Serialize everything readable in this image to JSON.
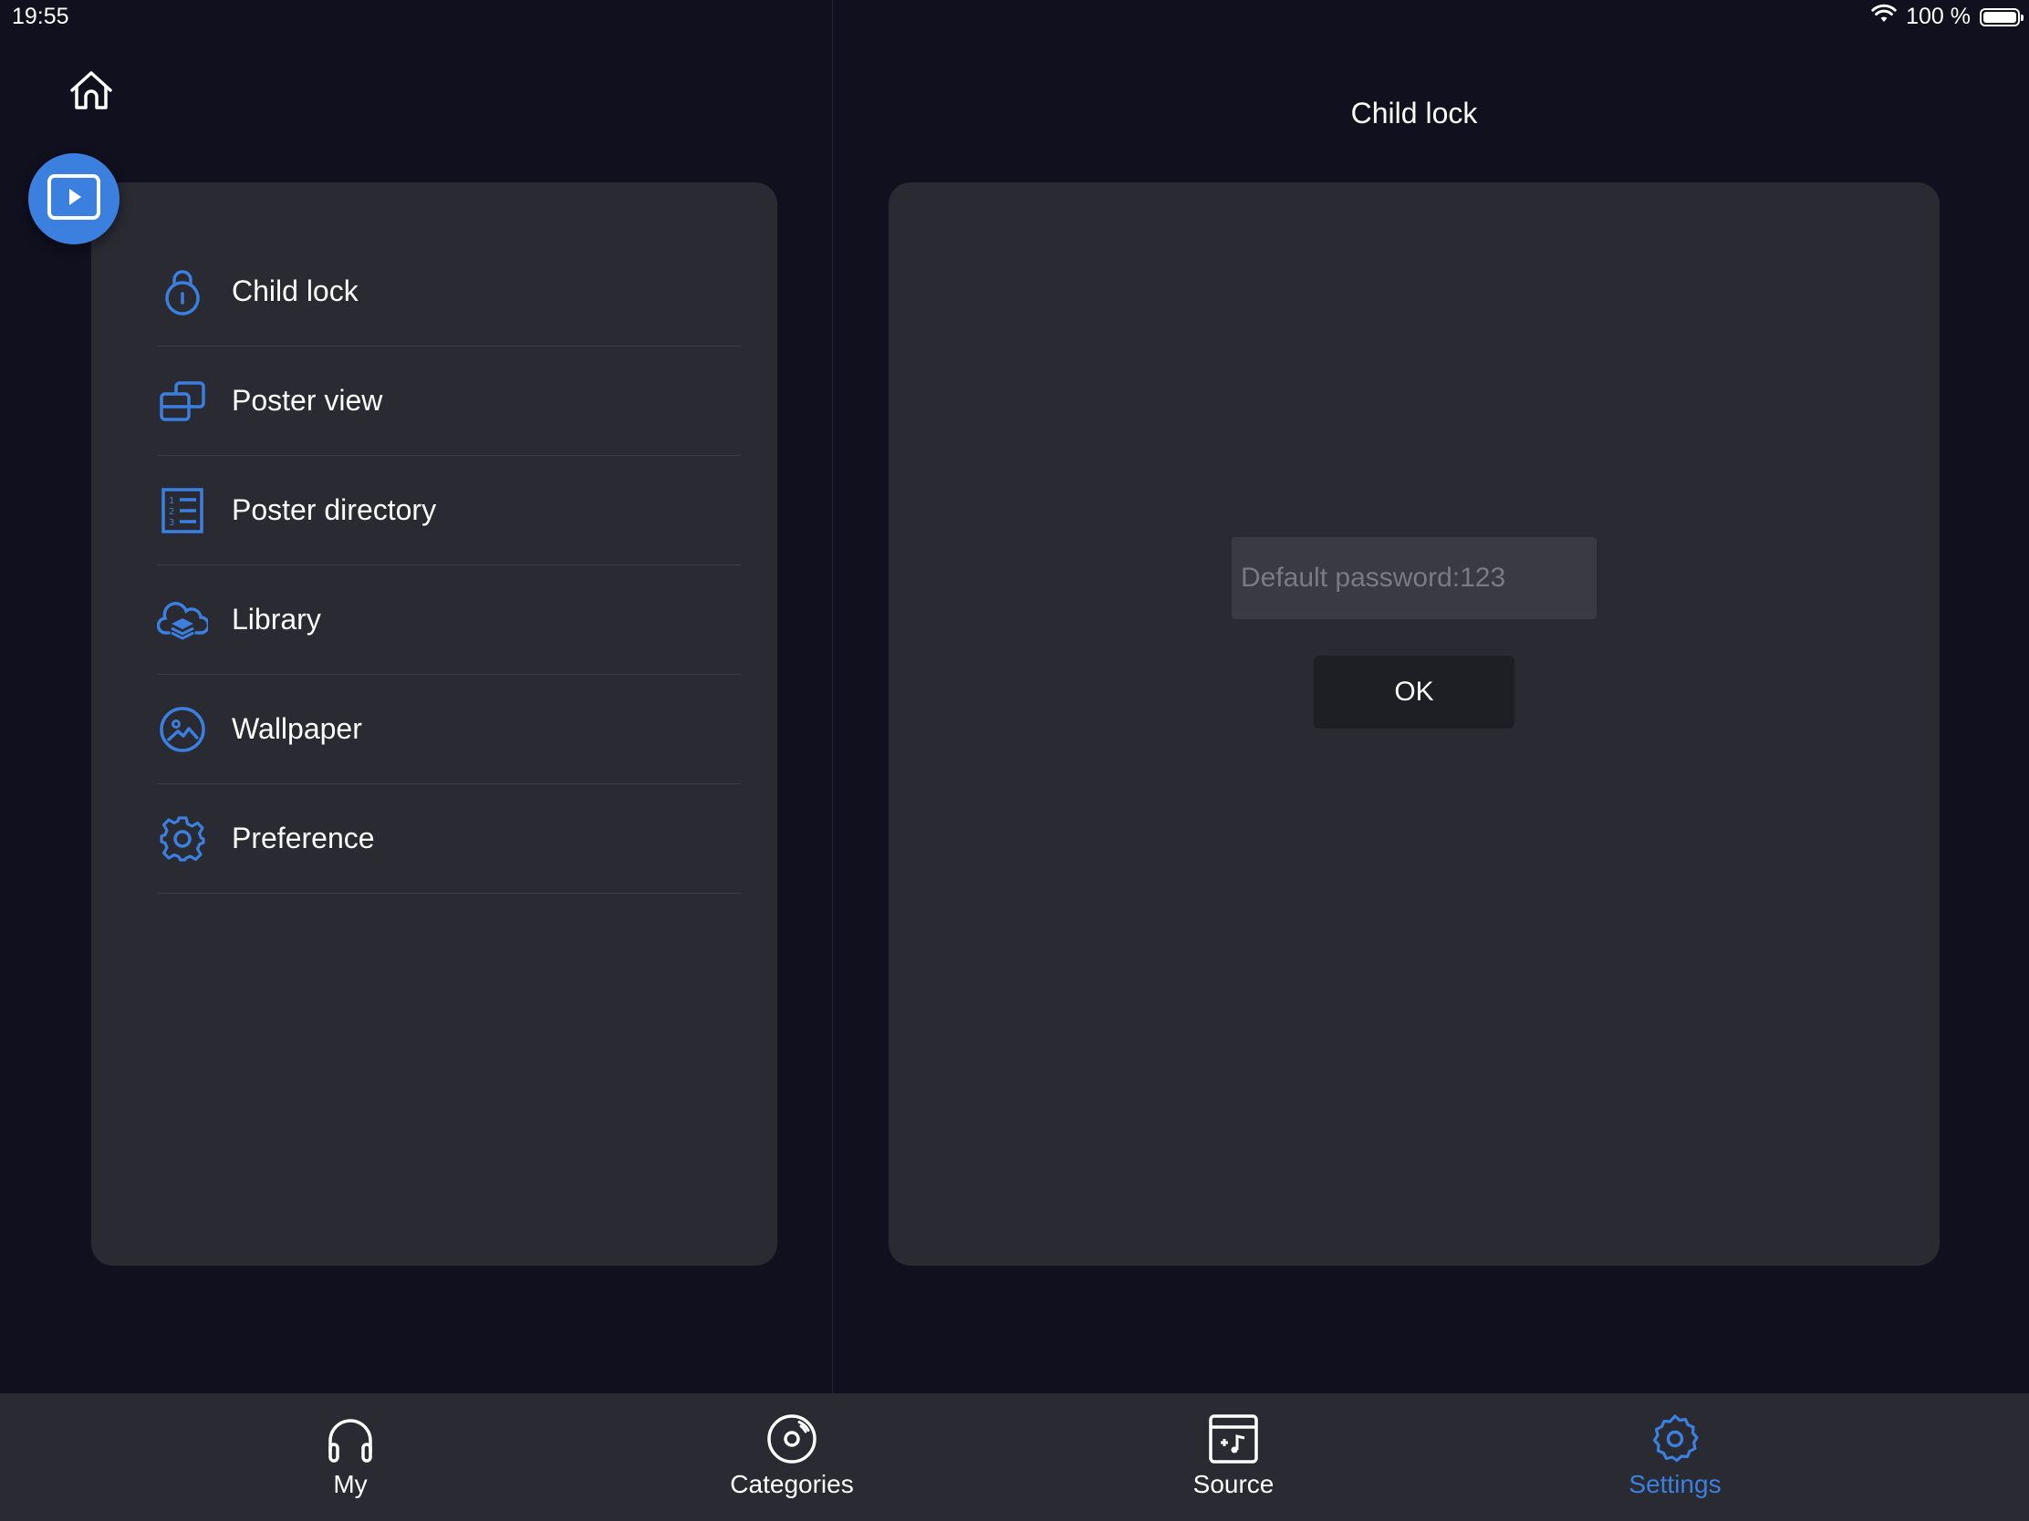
{
  "status_bar": {
    "time": "19:55",
    "battery": "100 %",
    "icons": [
      "wifi-icon",
      "battery-icon"
    ]
  },
  "colors": {
    "accent": "#3b7fdf",
    "background": "#10101f",
    "panel": "#2a2a33",
    "input": "#3a3a42",
    "button": "#1e1e25"
  },
  "menu": {
    "items": [
      {
        "label": "Child lock",
        "icon": "lock-icon"
      },
      {
        "label": "Poster view",
        "icon": "poster-view-icon"
      },
      {
        "label": "Poster directory",
        "icon": "numbered-list-icon"
      },
      {
        "label": "Library",
        "icon": "cloud-layers-icon"
      },
      {
        "label": "Wallpaper",
        "icon": "image-icon"
      },
      {
        "label": "Preference",
        "icon": "gear-icon"
      }
    ]
  },
  "detail": {
    "title": "Child lock",
    "password_placeholder": "Default password:123",
    "password_value": "",
    "ok_label": "OK"
  },
  "tab_bar": {
    "active": "Settings",
    "tabs": [
      {
        "label": "My",
        "icon": "headphones-icon"
      },
      {
        "label": "Categories",
        "icon": "disc-icon"
      },
      {
        "label": "Source",
        "icon": "music-folder-icon"
      },
      {
        "label": "Settings",
        "icon": "gear-icon"
      }
    ]
  }
}
